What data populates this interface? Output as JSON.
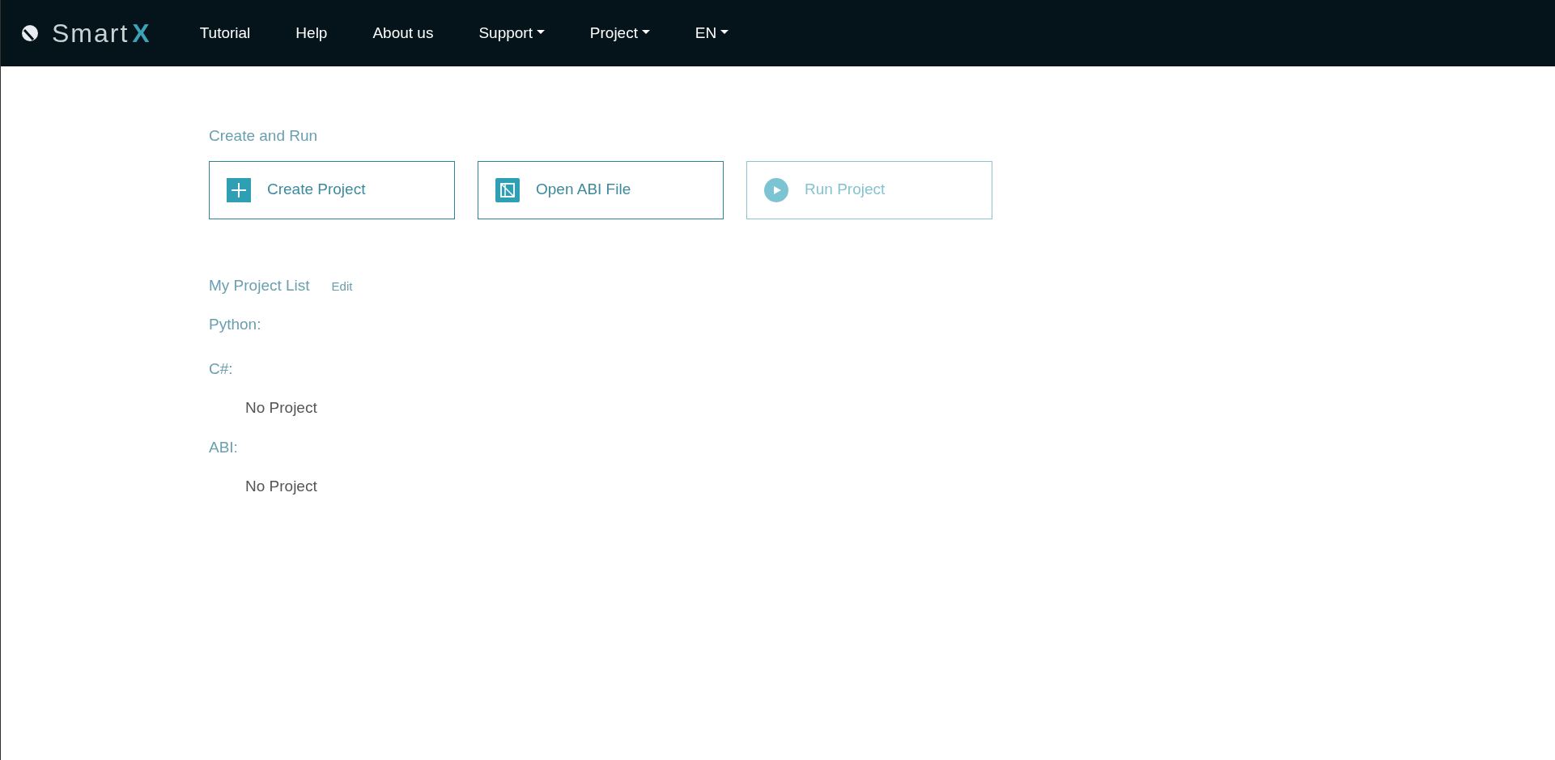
{
  "brand": {
    "name": "Smart",
    "mark": "X"
  },
  "nav": [
    {
      "label": "Tutorial",
      "dropdown": false
    },
    {
      "label": "Help",
      "dropdown": false
    },
    {
      "label": "About us",
      "dropdown": false
    },
    {
      "label": "Support",
      "dropdown": true
    },
    {
      "label": "Project",
      "dropdown": true
    },
    {
      "label": "EN",
      "dropdown": true
    }
  ],
  "create_section": {
    "title": "Create and Run",
    "actions": [
      {
        "label": "Create Project",
        "kind": "plus",
        "disabled": false
      },
      {
        "label": "Open ABI File",
        "kind": "file",
        "disabled": false
      },
      {
        "label": "Run Project",
        "kind": "play",
        "disabled": true
      }
    ]
  },
  "project_list": {
    "title": "My Project List",
    "edit": "Edit",
    "groups": [
      {
        "label": "Python:"
      },
      {
        "label": "C#:",
        "empty_text": "No Project"
      },
      {
        "label": "ABI:",
        "empty_text": "No Project"
      }
    ]
  }
}
